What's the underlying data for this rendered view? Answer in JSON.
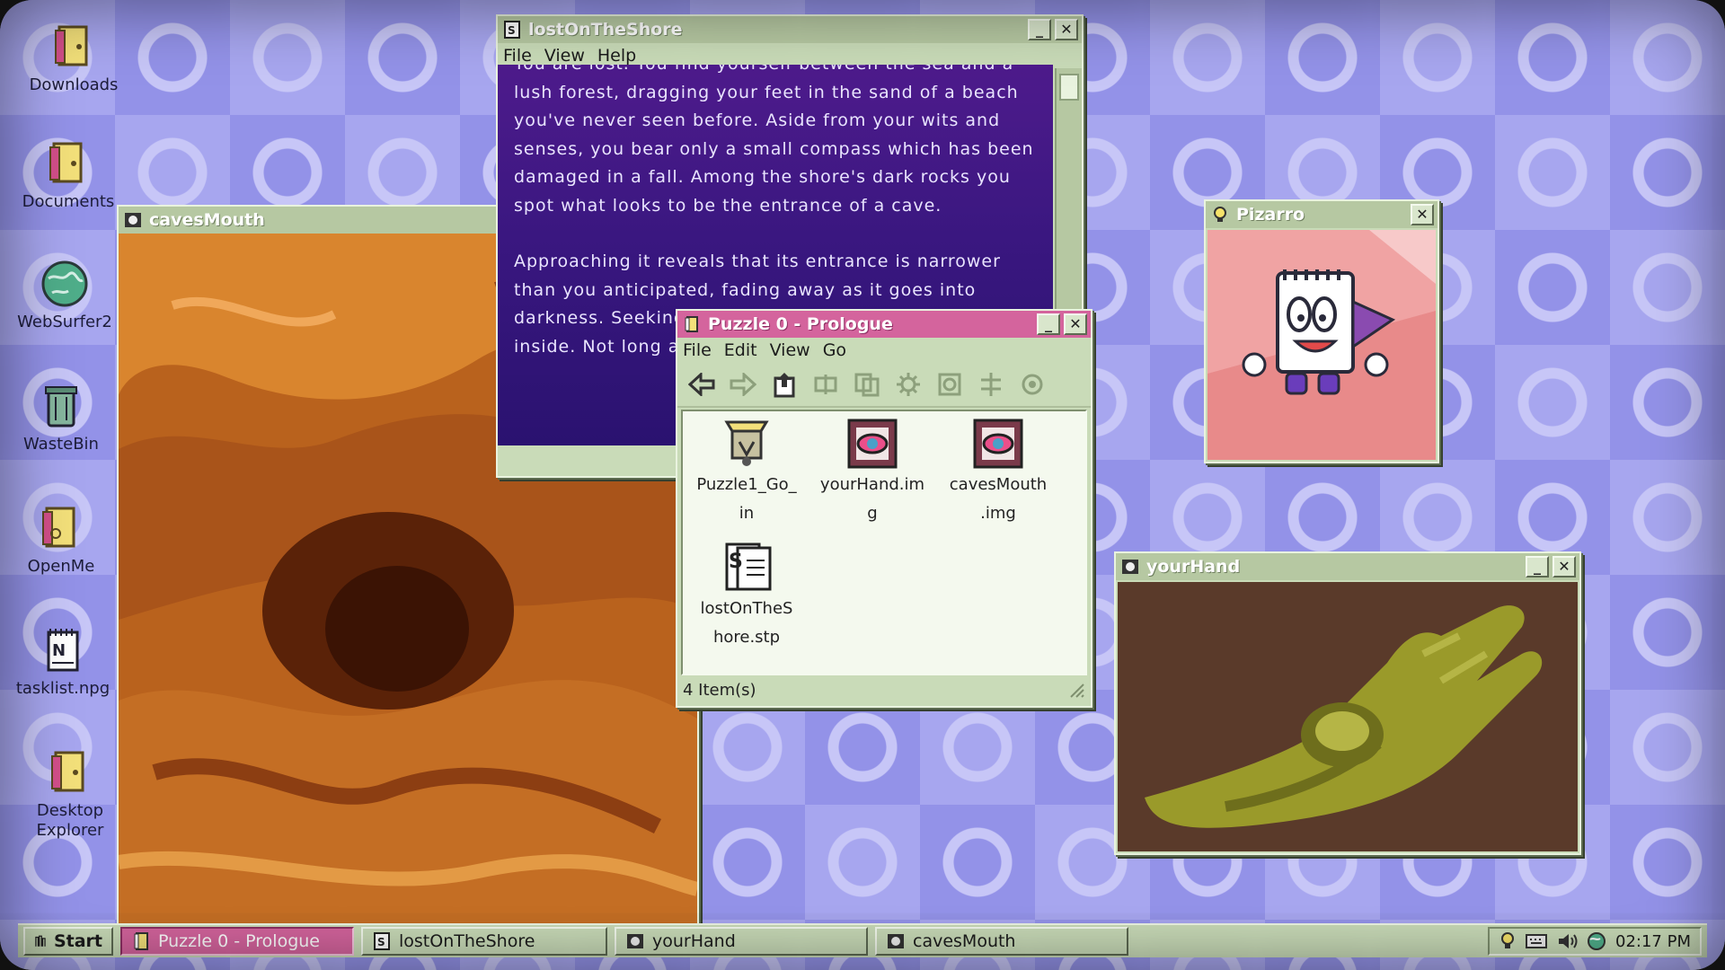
{
  "desktop": {
    "icons": [
      {
        "label": "Downloads",
        "icon": "folder-icon"
      },
      {
        "label": "Documents",
        "icon": "folder-icon"
      },
      {
        "label": "WebSurfer2",
        "icon": "globe-icon"
      },
      {
        "label": "WasteBin",
        "icon": "trash-icon"
      },
      {
        "label": "OpenMe",
        "icon": "folder-icon"
      },
      {
        "label": "tasklist.npg",
        "icon": "notepad-icon"
      },
      {
        "label": "Desktop",
        "label2": "Explorer",
        "icon": "folder-icon"
      }
    ]
  },
  "windows": {
    "story": {
      "title": "lostOnTheShore",
      "menu": [
        "File",
        "View",
        "Help"
      ],
      "paragraphs": [
        "You are lost. You find yourself between the sea and a lush forest, dragging your feet in the sand of a beach you've never seen before. Aside from your wits and senses, you bear only a small compass which has been damaged in a fall. Among the shore's dark rocks you spot what looks to be the entrance of a cave.",
        "Approaching it reveals that its entrance is narrower than you anticipated, fading away as it goes into darkness. Seeking shelter, you manage to squeeze inside. Not long after, it's the cave's natural light"
      ]
    },
    "caves": {
      "title": "cavesMouth"
    },
    "pizarro": {
      "title": "Pizarro"
    },
    "hand": {
      "title": "yourHand"
    },
    "explorer": {
      "title": "Puzzle 0 - Prologue",
      "menu": [
        "File",
        "Edit",
        "View",
        "Go"
      ],
      "files": [
        {
          "line1": "Puzzle1_Go_",
          "line2": "in",
          "icon": "archive-icon"
        },
        {
          "line1": "yourHand.im",
          "line2": "g",
          "icon": "image-icon"
        },
        {
          "line1": "cavesMouth",
          "line2": ".img",
          "icon": "image-icon"
        },
        {
          "line1": "lostOnTheS",
          "line2": "hore.stp",
          "icon": "script-icon"
        }
      ],
      "status": "4 Item(s)"
    }
  },
  "taskbar": {
    "start": "Start",
    "tasks": [
      "Puzzle 0 - Prologue",
      "lostOnTheShore",
      "yourHand",
      "cavesMouth"
    ],
    "clock": "02:17 PM"
  },
  "colors": {
    "accent": "#d4649d",
    "window": "#c9dbb8",
    "story_bg": "#3a1780"
  }
}
